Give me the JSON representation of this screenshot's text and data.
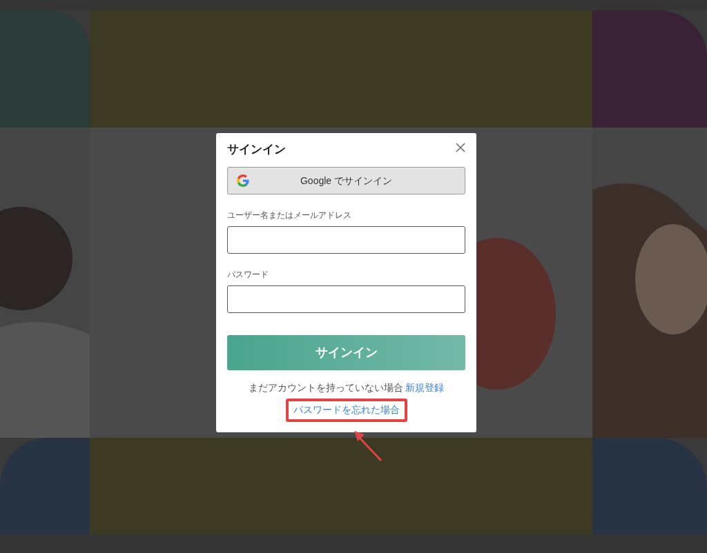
{
  "dialog": {
    "title": "サインイン",
    "google_button": {
      "label": "Google でサインイン"
    },
    "fields": [
      {
        "label": "ユーザー名またはメールアドレス"
      },
      {
        "label": "パスワード"
      }
    ],
    "submit_button": {
      "label": "サインイン"
    },
    "signup_prompt": {
      "text": "まだアカウントを持っていない場合",
      "link": "新規登録"
    },
    "forgot_link": {
      "label": "パスワードを忘れた場合",
      "highlighted": true
    }
  }
}
